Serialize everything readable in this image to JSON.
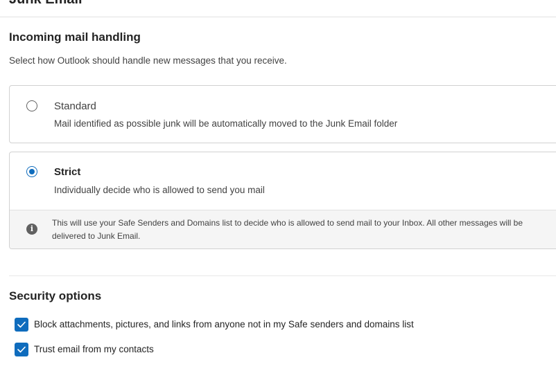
{
  "page": {
    "title": "Junk Email"
  },
  "incoming": {
    "heading": "Incoming mail handling",
    "description": "Select how Outlook should handle new messages that you receive.",
    "options": [
      {
        "title": "Standard",
        "description": "Mail identified as possible junk will be automatically moved to the Junk Email folder",
        "selected": false
      },
      {
        "title": "Strict",
        "description": "Individually decide who is allowed to send you mail",
        "selected": true,
        "info_icon": "info-icon",
        "info": "This will use your Safe Senders and Domains list to decide who is allowed to send mail to your Inbox. All other messages will be delivered to Junk Email."
      }
    ]
  },
  "security": {
    "heading": "Security options",
    "options": [
      {
        "label": "Block attachments, pictures, and links from anyone not in my Safe senders and domains list",
        "checked": true
      },
      {
        "label": "Trust email from my contacts",
        "checked": true
      }
    ]
  },
  "colors": {
    "accent": "#0f6cbd",
    "text_primary": "#242424",
    "text_secondary": "#424242",
    "border": "#d1d1d1",
    "info_bg": "#f5f5f5"
  }
}
